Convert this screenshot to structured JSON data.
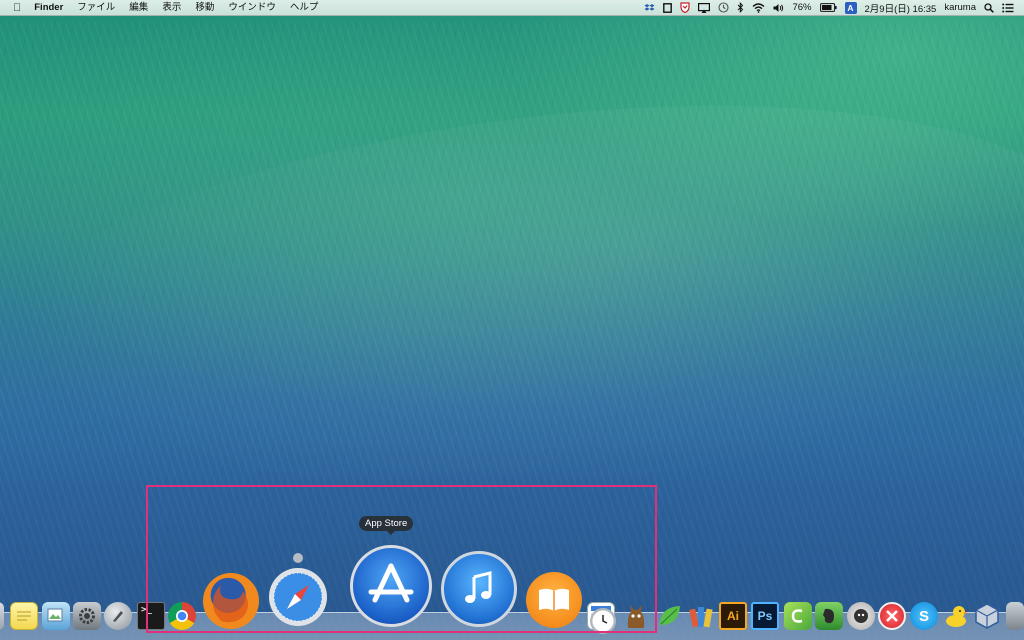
{
  "menubar": {
    "apple_icon": "apple-logo-icon",
    "app_name": "Finder",
    "menus": [
      "ファイル",
      "編集",
      "表示",
      "移動",
      "ウインドウ",
      "ヘルプ"
    ],
    "status": {
      "battery_percent": "76%",
      "input_method": "A",
      "datetime": "2月9日(日) 16:35",
      "user": "karuma"
    }
  },
  "dock": {
    "tooltip": "App Store",
    "icons": [
      "stickies-icon",
      "preview-icon",
      "system-preferences-icon",
      "launchpad-icon",
      "terminal-icon",
      "chrome-icon",
      "firefox-icon",
      "safari-icon",
      "app-store-icon",
      "itunes-icon",
      "ibooks-icon",
      "calendar-icon",
      "clock-icon",
      "cat-app-icon",
      "leaf-icon",
      "books-stack-icon",
      "illustrator-icon",
      "photoshop-icon",
      "coda-icon",
      "evernote-icon",
      "github-icon",
      "cross-app-icon",
      "skype-icon",
      "cyberduck-icon",
      "virtualbox-icon"
    ],
    "labels": {
      "illustrator": "Ai",
      "photoshop": "Ps",
      "skype": "S"
    }
  },
  "colors": {
    "highlight": "#e0307c",
    "menubar_bg": "#e6f2ee"
  }
}
